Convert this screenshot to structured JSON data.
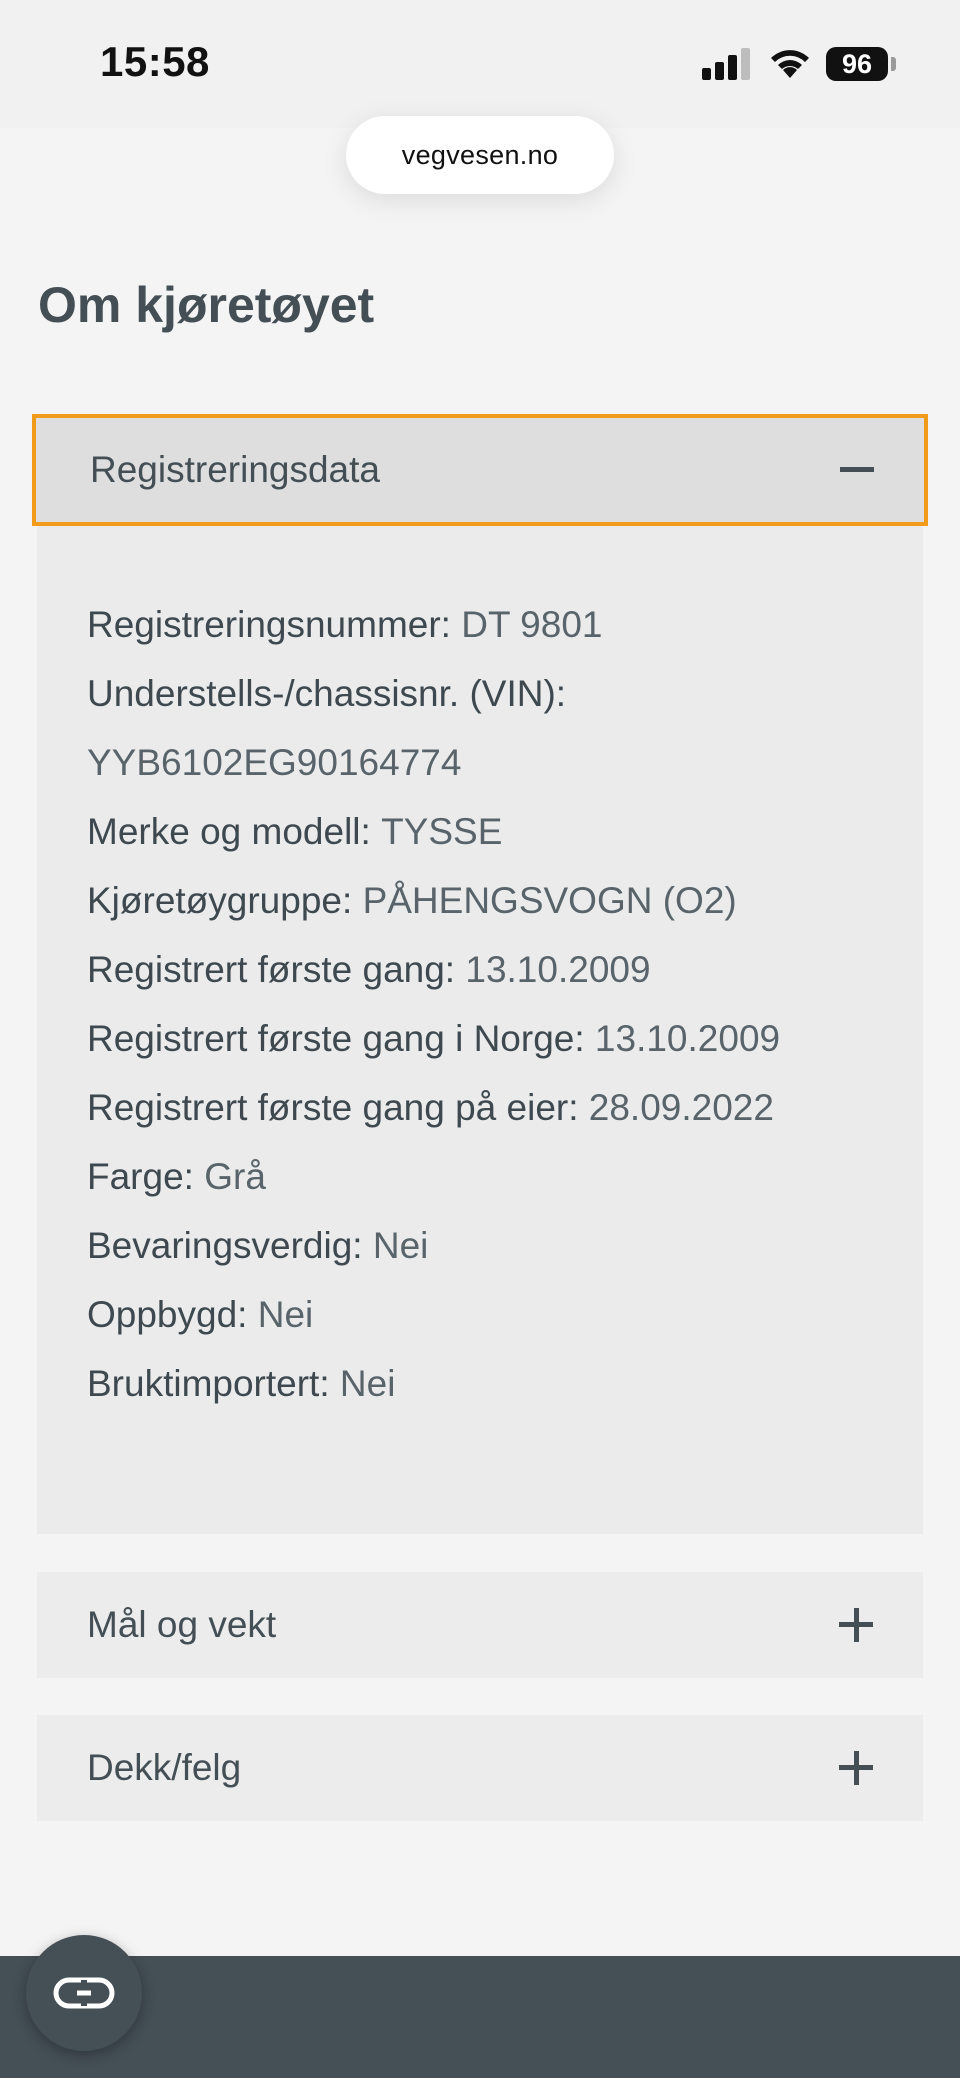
{
  "status_bar": {
    "time": "15:58",
    "battery": "96"
  },
  "browser": {
    "url": "vegvesen.no"
  },
  "page": {
    "title": "Om kjøretøyet"
  },
  "accordion": {
    "open_section": {
      "label": "Registreringsdata",
      "icon": "minus-icon",
      "rows": [
        {
          "label": "Registreringsnummer:",
          "value": "DT 9801"
        },
        {
          "label": "Understells-/chassisnr. (VIN):",
          "value": ""
        },
        {
          "label": "",
          "value": "YYB6102EG90164774"
        },
        {
          "label": "Merke og modell:",
          "value": "TYSSE"
        },
        {
          "label": "Kjøretøygruppe:",
          "value": "PÅHENGSVOGN (O2)"
        },
        {
          "label": "Registrert første gang:",
          "value": "13.10.2009"
        },
        {
          "label": "Registrert første gang i Norge:",
          "value": "13.10.2009"
        },
        {
          "label": "Registrert første gang på eier:",
          "value": "28.09.2022"
        },
        {
          "label": "Farge:",
          "value": "Grå"
        },
        {
          "label": "Bevaringsverdig:",
          "value": "Nei"
        },
        {
          "label": "Oppbygd:",
          "value": "Nei"
        },
        {
          "label": "Bruktimportert:",
          "value": "Nei"
        }
      ]
    },
    "collapsed_sections": [
      {
        "label": "Mål og vekt",
        "icon": "plus-icon"
      },
      {
        "label": "Dekk/felg",
        "icon": "plus-icon"
      }
    ]
  },
  "colors": {
    "accent_focus": "#f29a1a",
    "text": "#444f55",
    "bottom_bar": "#444f56"
  }
}
